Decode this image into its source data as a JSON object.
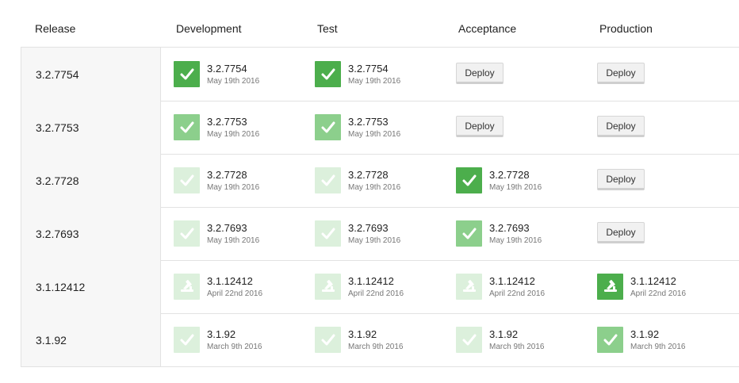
{
  "headers": [
    "Release",
    "Development",
    "Test",
    "Acceptance",
    "Production"
  ],
  "colors": {
    "dark": "#4cae4c",
    "medium": "#8ccf8c",
    "light": "#dcf0dc"
  },
  "deploy_label": "Deploy",
  "rows": [
    {
      "release": "3.2.7754",
      "cells": [
        {
          "kind": "badge",
          "level": "dark",
          "icon": "check-icon",
          "version": "3.2.7754",
          "date": "May 19th 2016"
        },
        {
          "kind": "badge",
          "level": "dark",
          "icon": "check-icon",
          "version": "3.2.7754",
          "date": "May 19th 2016"
        },
        {
          "kind": "deploy"
        },
        {
          "kind": "deploy"
        }
      ]
    },
    {
      "release": "3.2.7753",
      "cells": [
        {
          "kind": "badge",
          "level": "medium",
          "icon": "check-icon",
          "version": "3.2.7753",
          "date": "May 19th 2016"
        },
        {
          "kind": "badge",
          "level": "medium",
          "icon": "check-icon",
          "version": "3.2.7753",
          "date": "May 19th 2016"
        },
        {
          "kind": "deploy"
        },
        {
          "kind": "deploy"
        }
      ]
    },
    {
      "release": "3.2.7728",
      "cells": [
        {
          "kind": "badge",
          "level": "light",
          "icon": "check-icon",
          "version": "3.2.7728",
          "date": "May 19th 2016"
        },
        {
          "kind": "badge",
          "level": "light",
          "icon": "check-icon",
          "version": "3.2.7728",
          "date": "May 19th 2016"
        },
        {
          "kind": "badge",
          "level": "dark",
          "icon": "check-icon",
          "version": "3.2.7728",
          "date": "May 19th 2016"
        },
        {
          "kind": "deploy"
        }
      ]
    },
    {
      "release": "3.2.7693",
      "cells": [
        {
          "kind": "badge",
          "level": "light",
          "icon": "check-icon",
          "version": "3.2.7693",
          "date": "May 19th 2016"
        },
        {
          "kind": "badge",
          "level": "light",
          "icon": "check-icon",
          "version": "3.2.7693",
          "date": "May 19th 2016"
        },
        {
          "kind": "badge",
          "level": "medium",
          "icon": "check-icon",
          "version": "3.2.7693",
          "date": "May 19th 2016"
        },
        {
          "kind": "deploy"
        }
      ]
    },
    {
      "release": "3.1.12412",
      "cells": [
        {
          "kind": "badge",
          "level": "light",
          "icon": "hammer-icon",
          "version": "3.1.12412",
          "date": "April 22nd 2016"
        },
        {
          "kind": "badge",
          "level": "light",
          "icon": "hammer-icon",
          "version": "3.1.12412",
          "date": "April 22nd 2016"
        },
        {
          "kind": "badge",
          "level": "light",
          "icon": "hammer-icon",
          "version": "3.1.12412",
          "date": "April 22nd 2016"
        },
        {
          "kind": "badge",
          "level": "dark",
          "icon": "hammer-icon",
          "version": "3.1.12412",
          "date": "April 22nd 2016"
        }
      ]
    },
    {
      "release": "3.1.92",
      "cells": [
        {
          "kind": "badge",
          "level": "light",
          "icon": "check-icon",
          "version": "3.1.92",
          "date": "March 9th 2016"
        },
        {
          "kind": "badge",
          "level": "light",
          "icon": "check-icon",
          "version": "3.1.92",
          "date": "March 9th 2016"
        },
        {
          "kind": "badge",
          "level": "light",
          "icon": "check-icon",
          "version": "3.1.92",
          "date": "March 9th 2016"
        },
        {
          "kind": "badge",
          "level": "medium",
          "icon": "check-icon",
          "version": "3.1.92",
          "date": "March 9th 2016"
        }
      ]
    }
  ]
}
